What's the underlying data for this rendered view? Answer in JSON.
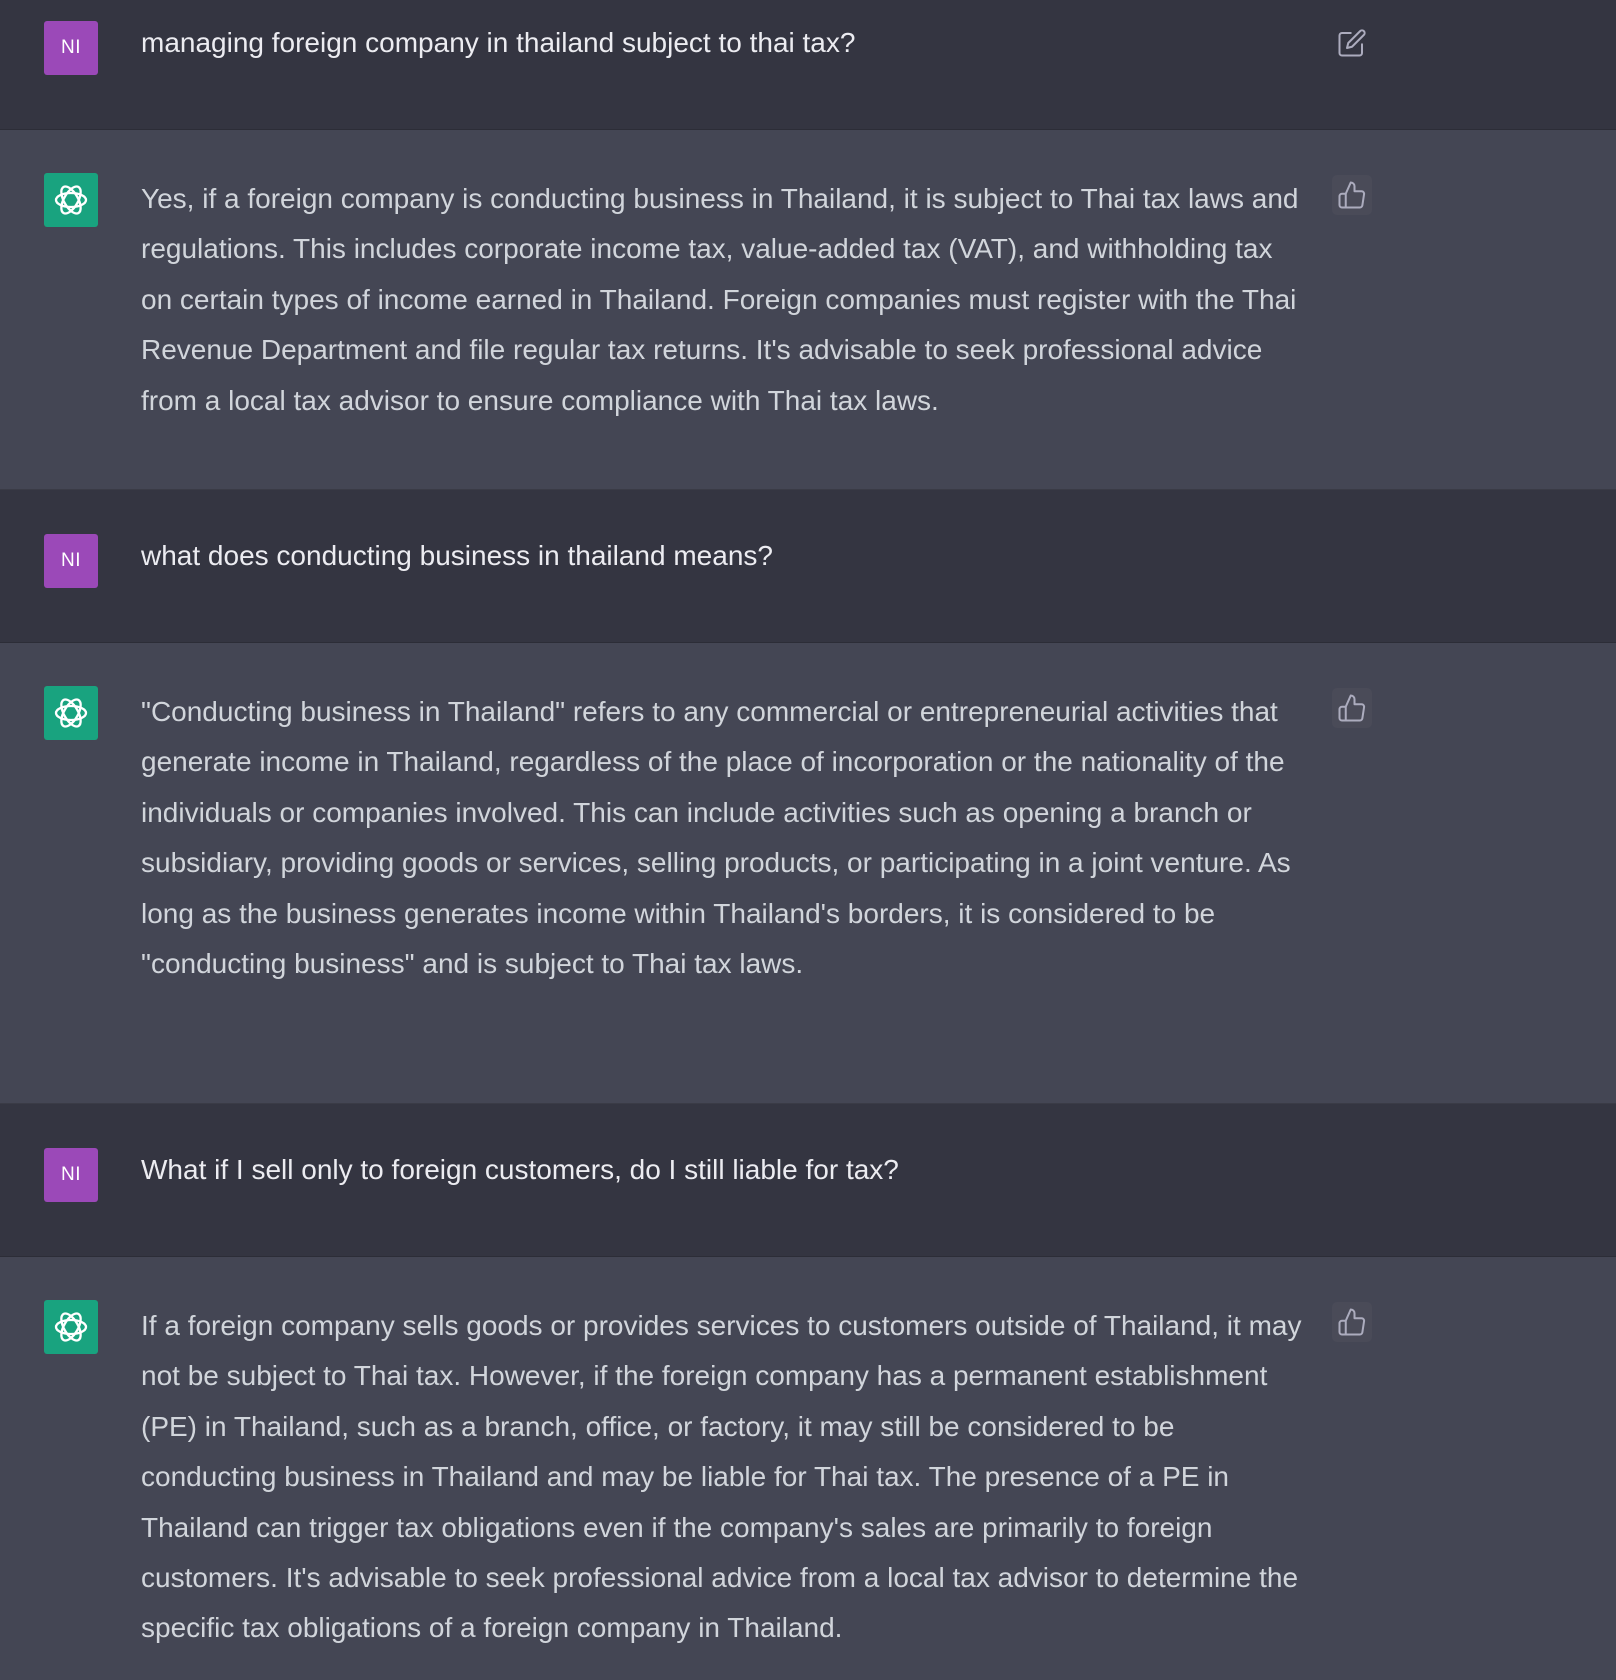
{
  "user_initials": "NI",
  "colors": {
    "user_avatar": "#9b49b8",
    "assistant_avatar": "#19a37f",
    "user_bg": "#343541",
    "assistant_bg": "#444654"
  },
  "conversation": [
    {
      "role": "user",
      "icon": "edit-icon",
      "text": "managing foreign company in thailand subject to thai tax?"
    },
    {
      "role": "assistant",
      "icon": "thumbs-up-icon",
      "text": "Yes, if a foreign company is conducting business in Thailand, it is subject to Thai tax laws and regulations. This includes corporate income tax, value-added tax (VAT), and withholding tax on certain types of income earned in Thailand. Foreign companies must register with the Thai Revenue Department and file regular tax returns. It's advisable to seek professional advice from a local tax advisor to ensure compliance with Thai tax laws."
    },
    {
      "role": "user",
      "text": "what does conducting business in thailand means?"
    },
    {
      "role": "assistant",
      "icon": "thumbs-up-icon",
      "text": "\"Conducting business in Thailand\" refers to any commercial or entrepreneurial activities that generate income in Thailand, regardless of the place of incorporation or the nationality of the individuals or companies involved. This can include activities such as opening a branch or subsidiary, providing goods or services, selling products, or participating in a joint venture. As long as the business generates income within Thailand's borders, it is considered to be \"conducting business\" and is subject to Thai tax laws."
    },
    {
      "role": "user",
      "text": "What if I sell only to foreign customers, do I still liable for tax?"
    },
    {
      "role": "assistant",
      "icon": "thumbs-up-icon",
      "text": "If a foreign company sells goods or provides services to customers outside of Thailand, it may not be subject to Thai tax. However, if the foreign company has a permanent establishment (PE) in Thailand, such as a branch, office, or factory, it may still be considered to be conducting business in Thailand and may be liable for Thai tax. The presence of a PE in Thailand can trigger tax obligations even if the company's sales are primarily to foreign customers. It's advisable to seek professional advice from a local tax advisor to determine the specific tax obligations of a foreign company in Thailand."
    }
  ]
}
